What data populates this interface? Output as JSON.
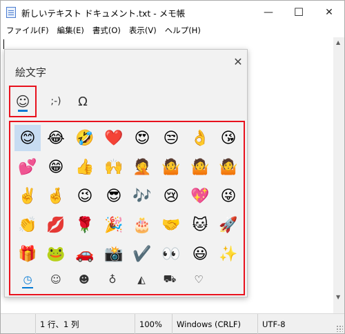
{
  "window": {
    "title": "新しいテキスト ドキュメント.txt - メモ帳",
    "minimize_glyph": "—",
    "maximize_glyph": "☐",
    "close_glyph": "✕"
  },
  "menu": [
    "ファイル(F)",
    "編集(E)",
    "書式(O)",
    "表示(V)",
    "ヘルプ(H)"
  ],
  "status": {
    "position": "1 行、1 列",
    "zoom": "100%",
    "line_ending": "Windows (CRLF)",
    "encoding": "UTF-8"
  },
  "emoji_panel": {
    "title": "絵文字",
    "close_glyph": "✕",
    "tabs": [
      {
        "name": "emoji",
        "label": "☺"
      },
      {
        "name": "kaomoji",
        "label": ";-)"
      },
      {
        "name": "symbols",
        "label": "Ω"
      }
    ],
    "emoji_rows": [
      [
        "😊",
        "😂",
        "🤣",
        "❤️",
        "😍",
        "😒",
        "👌",
        "😘"
      ],
      [
        "💕",
        "😁",
        "👍",
        "🙌",
        "🤦",
        "🤷",
        "🤷",
        "🤷"
      ],
      [
        "✌️",
        "🤞",
        "😉",
        "😎",
        "🎶",
        "😢",
        "💖",
        "😜"
      ],
      [
        "👏",
        "💋",
        "🌹",
        "🎉",
        "🎂",
        "🤝",
        "🐱",
        "🚀"
      ],
      [
        "🎁",
        "🐸",
        "🚗",
        "📸",
        "✔️",
        "👀",
        "😃",
        "✨"
      ]
    ],
    "subcategories": [
      "recent-icon",
      "smiley-icon",
      "person-icon",
      "balloon-icon",
      "pizza-icon",
      "car-icon",
      "heart-icon"
    ],
    "subcategory_glyphs": [
      "◷",
      "☺",
      "☻",
      "♁",
      "◭",
      "⛟",
      "♡"
    ]
  },
  "colors": {
    "highlight_red": "#e8101c",
    "accent_blue": "#0078d4",
    "selected_cell": "#c7dcf2"
  }
}
